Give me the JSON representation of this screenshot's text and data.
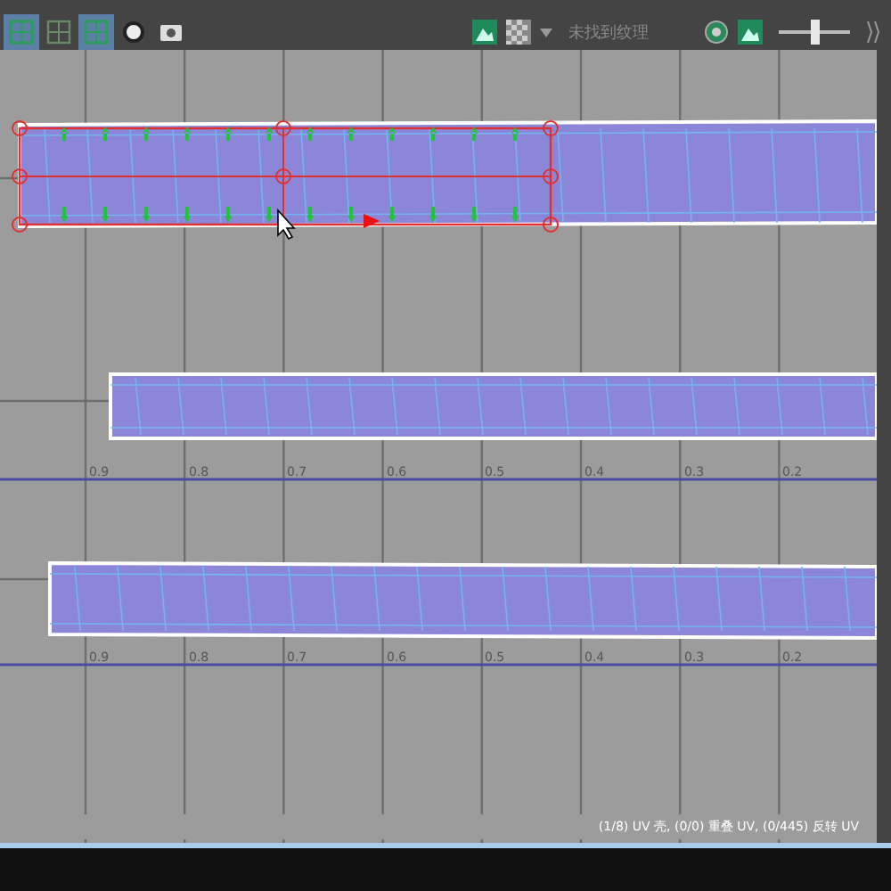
{
  "toolbar": {
    "tools": [
      {
        "kind": "grid-square",
        "selected": true
      },
      {
        "kind": "grid-plus",
        "selected": false
      },
      {
        "kind": "grid-square",
        "selected": true
      },
      {
        "kind": "ring",
        "selected": false
      },
      {
        "kind": "camera",
        "selected": false
      }
    ],
    "texture_status": "未找到纹理",
    "zoom_slider": {
      "level": 0.5
    }
  },
  "canvas": {
    "tick_rows": [
      [
        "0.9",
        "0.8",
        "0.7",
        "0.6",
        "0.5",
        "0.4",
        "0.3",
        "0.2"
      ],
      [
        "0.9",
        "0.8",
        "0.7",
        "0.6",
        "0.5",
        "0.4",
        "0.3",
        "0.2"
      ]
    ]
  },
  "status_bar": "(1/8) UV 壳, (0/0) 重叠 UV, (0/445) 反转 UV"
}
